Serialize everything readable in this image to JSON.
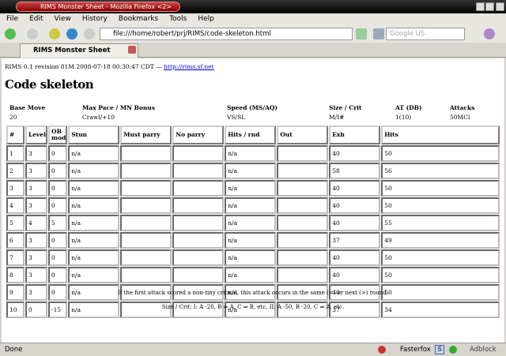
{
  "window": {
    "title": "RIMS Monster Sheet - Mozilla Firefox <2>"
  },
  "menu": [
    "File",
    "Edit",
    "View",
    "History",
    "Bookmarks",
    "Tools",
    "Help"
  ],
  "navbar": {
    "url": "file:///home/robert/prj/RIMS/code-skeleton.html",
    "search_placeholder": "Google US"
  },
  "tab": {
    "label": "RIMS Monster Sheet"
  },
  "page": {
    "revision": "RIMS 0.1 revision 81M 2008-07-18 00:30:47 CDT — ",
    "link": "http://rims.sf.net",
    "title": "Code skeleton",
    "stats": [
      {
        "label": "Base Move",
        "value": "20"
      },
      {
        "label": "Max Pace / MN Bonus",
        "value": "Crawl/+10"
      },
      {
        "label": "Speed (MS/AQ)",
        "value": "VS/SL"
      },
      {
        "label": "Size / Crit",
        "value": "M/I#"
      },
      {
        "label": "AT (DB)",
        "value": "1(10)"
      },
      {
        "label": "Attacks",
        "value": "50MCl"
      }
    ],
    "columns": [
      "#",
      "Level",
      "OB mod",
      "Stun",
      "Must parry",
      "No parry",
      "Hits / rnd",
      "Out",
      "Exh",
      "Hits"
    ],
    "rows": [
      [
        "1",
        "3",
        "0",
        "n/a",
        "",
        "",
        "n/a",
        "",
        "40",
        "50"
      ],
      [
        "2",
        "3",
        "0",
        "n/a",
        "",
        "",
        "n/a",
        "",
        "58",
        "56"
      ],
      [
        "3",
        "3",
        "0",
        "n/a",
        "",
        "",
        "n/a",
        "",
        "40",
        "50"
      ],
      [
        "4",
        "3",
        "0",
        "n/a",
        "",
        "",
        "n/a",
        "",
        "40",
        "50"
      ],
      [
        "5",
        "4",
        "5",
        "n/a",
        "",
        "",
        "n/a",
        "",
        "40",
        "55"
      ],
      [
        "6",
        "3",
        "0",
        "n/a",
        "",
        "",
        "n/a",
        "",
        "37",
        "49"
      ],
      [
        "7",
        "3",
        "0",
        "n/a",
        "",
        "",
        "n/a",
        "",
        "40",
        "50"
      ],
      [
        "8",
        "3",
        "0",
        "n/a",
        "",
        "",
        "n/a",
        "",
        "40",
        "50"
      ],
      [
        "9",
        "3",
        "0",
        "n/a",
        "",
        "",
        "n/a",
        "",
        "40",
        "50"
      ],
      [
        "10",
        "0",
        "-15",
        "n/a",
        "",
        "",
        "n/a",
        "",
        "37",
        "34"
      ]
    ],
    "note1": "If the first attack scored a non-tiny critical, this attack occurs in the same (<) or next (>) round.",
    "note2": "Size / Crit: I: A -20, B ⇒ A, C ⇒ B, etc. II: A -50, B -20, C ⇒ A, etc."
  },
  "statusbar": {
    "text": "Done",
    "fasterfox": "Fasterfox",
    "adblock": "Adblock"
  }
}
